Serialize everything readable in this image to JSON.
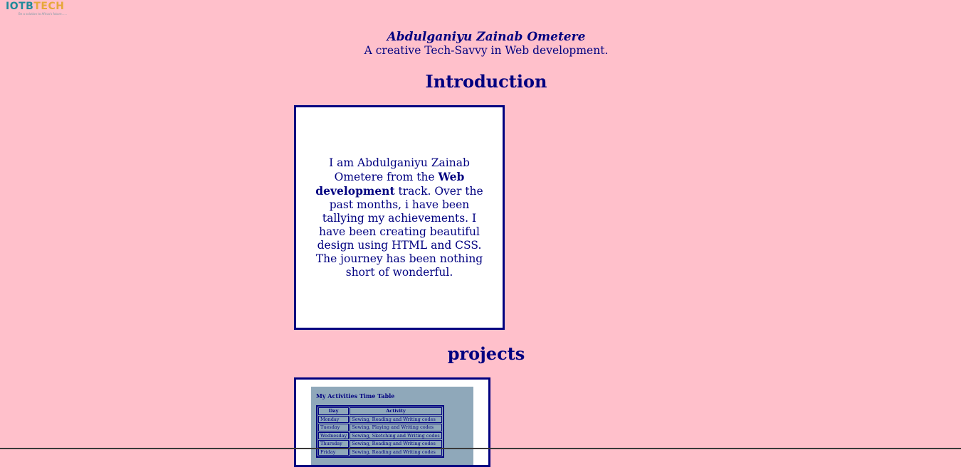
{
  "logo": {
    "brand_part1": "IOTB",
    "brand_part2": "TECH",
    "tagline": "Be a solution to Africa's future......"
  },
  "header": {
    "name": "Abdulganiyu Zainab Ometere",
    "tagline": "A creative Tech-Savvy in Web development."
  },
  "introduction": {
    "title": "Introduction",
    "text_before": "I am Abdulganiyu Zainab Ometere from the ",
    "text_bold": "Web development",
    "text_after": " track. Over the past months, i have been tallying my achievements. I have been creating beautiful design using HTML and CSS. The journey has been nothing short of wonderful."
  },
  "projects": {
    "title": "projects",
    "preview": {
      "title": "My Activities Time Table",
      "headers": [
        "Day",
        "Activity"
      ],
      "rows": [
        [
          "Monday",
          "Sewing, Reading and Writing codes"
        ],
        [
          "Tuesday",
          "Sewing, Playing and Writing codes"
        ],
        [
          "Wednesday",
          "Sewing, Sketching and Writing codes"
        ],
        [
          "Thursday",
          "Sewing, Reading and Writing codes"
        ],
        [
          "Friday",
          "Sewing, Reading and Writing codes"
        ]
      ]
    }
  },
  "colors": {
    "background": "#ffc0cb",
    "text": "#000080",
    "card": "#ffffff",
    "preview_background": "#8fa8ba",
    "logo_teal": "#1f8a99",
    "logo_orange": "#e6a73a"
  }
}
